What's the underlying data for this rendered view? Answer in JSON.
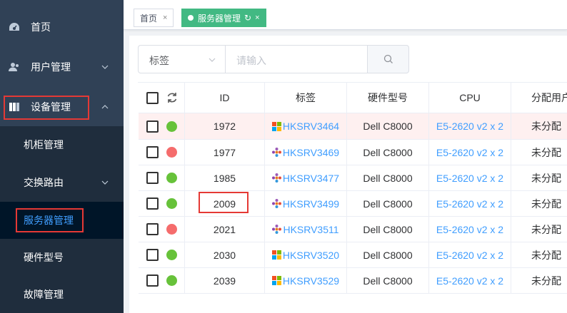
{
  "sidebar": {
    "items": [
      {
        "label": "首页",
        "icon": "dashboard-icon"
      },
      {
        "label": "用户管理",
        "icon": "user-icon"
      },
      {
        "label": "设备管理",
        "icon": "server-icon"
      }
    ],
    "sub_items": [
      {
        "label": "机柜管理"
      },
      {
        "label": "交换路由"
      },
      {
        "label": "服务器管理"
      },
      {
        "label": "硬件型号"
      },
      {
        "label": "故障管理"
      }
    ]
  },
  "tags": {
    "home": "首页",
    "active": "服务器管理"
  },
  "search": {
    "select_value": "标签",
    "placeholder": "请输入"
  },
  "table": {
    "headers": [
      "ID",
      "标签",
      "硬件型号",
      "CPU",
      "分配用户"
    ],
    "rows": [
      {
        "status": "green",
        "id": "1972",
        "tag": "HKSRV3464",
        "os": "windows",
        "model": "Dell C8000",
        "cpu": "E5-2620 v2 x 2",
        "assign": "未分配"
      },
      {
        "status": "red",
        "id": "1977",
        "tag": "HKSRV3469",
        "os": "other",
        "model": "Dell C8000",
        "cpu": "E5-2620 v2 x 2",
        "assign": "未分配"
      },
      {
        "status": "green",
        "id": "1985",
        "tag": "HKSRV3477",
        "os": "other",
        "model": "Dell C8000",
        "cpu": "E5-2620 v2 x 2",
        "assign": "未分配"
      },
      {
        "status": "green",
        "id": "2009",
        "tag": "HKSRV3499",
        "os": "other",
        "model": "Dell C8000",
        "cpu": "E5-2620 v2 x 2",
        "assign": "未分配"
      },
      {
        "status": "red",
        "id": "2021",
        "tag": "HKSRV3511",
        "os": "other",
        "model": "Dell C8000",
        "cpu": "E5-2620 v2 x 2",
        "assign": "未分配"
      },
      {
        "status": "green",
        "id": "2030",
        "tag": "HKSRV3520",
        "os": "windows",
        "model": "Dell C8000",
        "cpu": "E5-2620 v2 x 2",
        "assign": "未分配"
      },
      {
        "status": "green",
        "id": "2039",
        "tag": "HKSRV3529",
        "os": "windows",
        "model": "Dell C8000",
        "cpu": "E5-2620 v2 x 2",
        "assign": "未分配"
      }
    ]
  },
  "colors": {
    "sidebar_bg": "#304156",
    "submenu_bg": "#1f2d3d",
    "accent": "#409eff",
    "tag_active": "#42b983",
    "status_green": "#67c23a",
    "status_red": "#f56c6c",
    "highlight_box": "#e53935"
  }
}
